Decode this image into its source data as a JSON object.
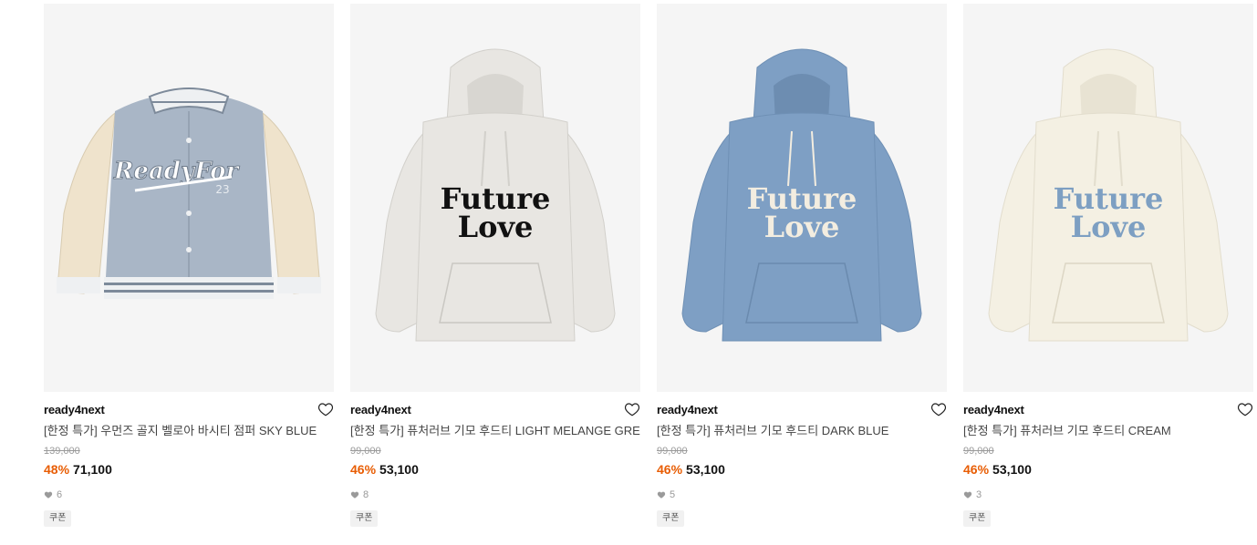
{
  "products": [
    {
      "brand": "ready4next",
      "title": "[한정 특가] 우먼즈 골지 벨로아 바시티 점퍼 SKY BLUE",
      "original_price": "139,000",
      "discount": "48%",
      "price": "71,100",
      "likes": "6",
      "badge": "쿠폰",
      "image": {
        "type": "varsity-jacket",
        "body_color": "#a9b6c6",
        "sleeve_color": "#efe3cc",
        "graphic_text": "ReadyFor",
        "graphic_number": "23"
      }
    },
    {
      "brand": "ready4next",
      "title": "[한정 특가] 퓨처러브 기모 후드티 LIGHT MELANGE GREY",
      "original_price": "99,000",
      "discount": "46%",
      "price": "53,100",
      "likes": "8",
      "badge": "쿠폰",
      "image": {
        "type": "hoodie",
        "body_color": "#e8e6e2",
        "text_color": "#111111",
        "graphic_line1": "Future",
        "graphic_line2": "Love"
      }
    },
    {
      "brand": "ready4next",
      "title": "[한정 특가] 퓨처러브 기모 후드티 DARK BLUE",
      "original_price": "99,000",
      "discount": "46%",
      "price": "53,100",
      "likes": "5",
      "badge": "쿠폰",
      "image": {
        "type": "hoodie",
        "body_color": "#7e9fc4",
        "text_color": "#f3ede0",
        "graphic_line1": "Future",
        "graphic_line2": "Love"
      }
    },
    {
      "brand": "ready4next",
      "title": "[한정 특가] 퓨처러브 기모 후드티 CREAM",
      "original_price": "99,000",
      "discount": "46%",
      "price": "53,100",
      "likes": "3",
      "badge": "쿠폰",
      "image": {
        "type": "hoodie",
        "body_color": "#f4f0e3",
        "text_color": "#7d9fc2",
        "graphic_line1": "Future",
        "graphic_line2": "Love"
      }
    }
  ],
  "colors": {
    "discount": "#e85d04",
    "thumb_bg": "#f5f5f5"
  },
  "icons": {
    "wishlist": "heart-outline-icon",
    "likes": "heart-filled-icon"
  }
}
